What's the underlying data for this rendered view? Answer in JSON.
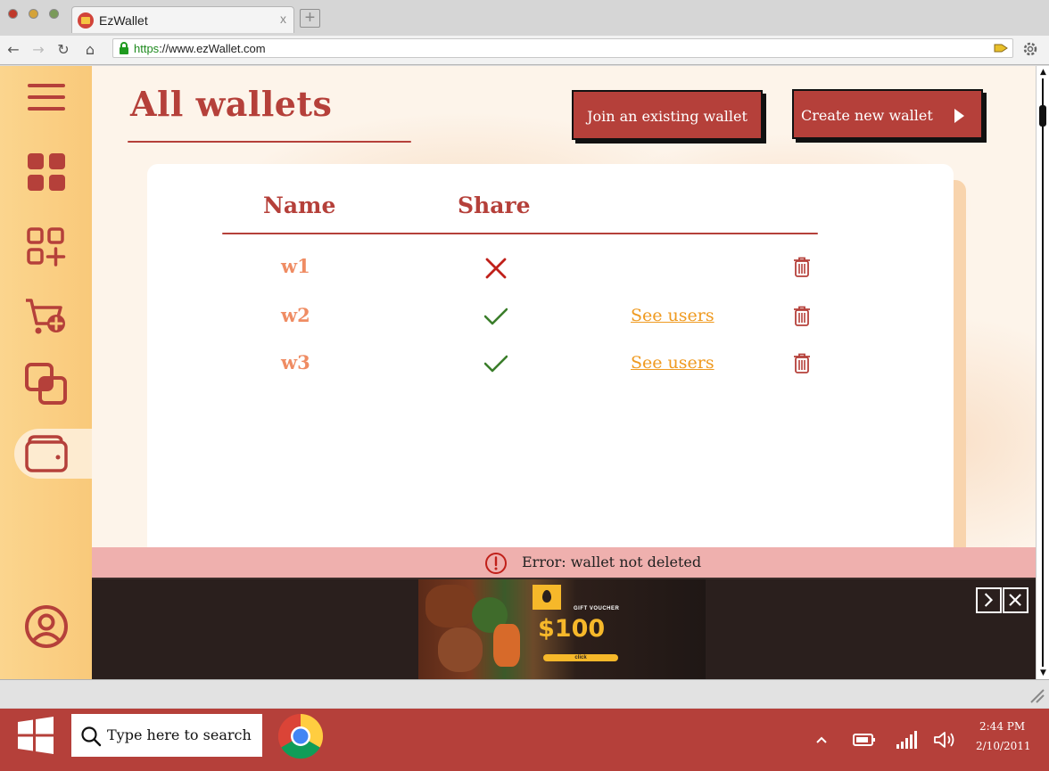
{
  "browser": {
    "tab_title": "EzWallet",
    "tab_close": "x",
    "new_tab": "+",
    "url_scheme": "https",
    "url_rest": "://www.ezWallet.com",
    "back": "←",
    "forward": "→",
    "reload": "↻",
    "home": "⌂"
  },
  "sidebar": {
    "items": [
      {
        "icon": "menu-icon"
      },
      {
        "icon": "dashboard-grid-icon"
      },
      {
        "icon": "add-category-icon"
      },
      {
        "icon": "cart-add-icon"
      },
      {
        "icon": "transactions-copy-icon"
      },
      {
        "icon": "wallet-icon",
        "active": true
      },
      {
        "icon": "profile-icon"
      }
    ]
  },
  "page": {
    "title": "All wallets",
    "join_button": "Join an existing wallet",
    "create_button": "Create new wallet"
  },
  "table": {
    "headers": {
      "name": "Name",
      "share": "Share"
    },
    "rows": [
      {
        "name": "w1",
        "shared": false,
        "link": ""
      },
      {
        "name": "w2",
        "shared": true,
        "link": "See users"
      },
      {
        "name": "w3",
        "shared": true,
        "link": "See users"
      }
    ]
  },
  "error": {
    "message": "Error: wallet not deleted"
  },
  "ad": {
    "voucher_label": "GIFT VOUCHER",
    "amount": "$100",
    "cta": "click"
  },
  "taskbar": {
    "search_placeholder": "Type here to search",
    "time": "2:44 PM",
    "date": "2/10/2011"
  },
  "colors": {
    "brand": "#b5403a",
    "sidebar": "#f9c97a",
    "name_text": "#ef8c63",
    "link": "#ef9a20",
    "error_bg": "#efb0ae",
    "check": "#3a7d2a",
    "cross": "#c0201a"
  }
}
